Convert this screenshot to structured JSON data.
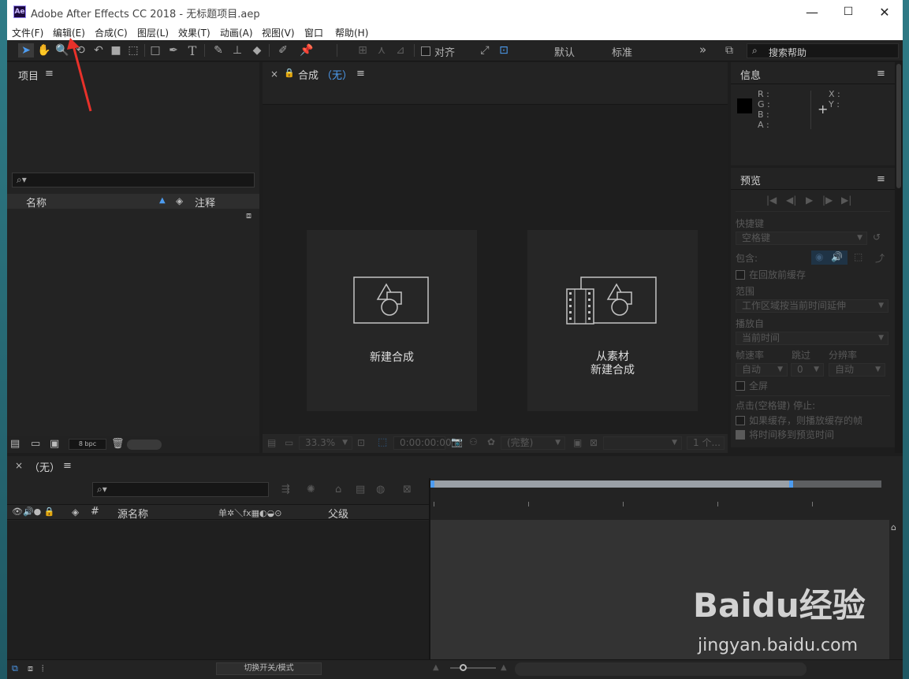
{
  "window": {
    "title": "Adobe After Effects CC 2018 - 无标题项目.aep",
    "logo_text": "Ae",
    "minimize": "—",
    "maximize": "☐",
    "close": "✕"
  },
  "menu": [
    "文件(F)",
    "编辑(E)",
    "合成(C)",
    "图层(L)",
    "效果(T)",
    "动画(A)",
    "视图(V)",
    "窗口",
    "帮助(H)"
  ],
  "toolbar": {
    "align_label": "对齐",
    "workspace_default": "默认",
    "workspace_standard": "标准",
    "more": "»",
    "search_placeholder": "搜索帮助"
  },
  "project_panel": {
    "title": "项目",
    "menu": "≡",
    "col_name": "名称",
    "col_comment": "注释",
    "bpc": "8 bpc"
  },
  "comp_panel": {
    "close": "×",
    "title": "合成",
    "comp_name": "（无）",
    "menu": "≡",
    "card_new_comp": "新建合成",
    "card_from_footage_line1": "从素材",
    "card_from_footage_line2": "新建合成",
    "zoom": "33.3%",
    "timecode": "0:00:00:00",
    "quality": "(完整)",
    "views": "1 个..."
  },
  "info_panel": {
    "title": "信息",
    "menu": "≡",
    "r": "R :",
    "g": "G :",
    "b": "B :",
    "a": "A :",
    "x": "X :",
    "y": "Y :",
    "swatch_color": "#000000"
  },
  "preview_panel": {
    "title": "预览",
    "menu": "≡",
    "shortcut_label": "快捷键",
    "shortcut_value": "空格键",
    "include_label": "包含:",
    "cache_before_play": "在回放前缓存",
    "range_label": "范围",
    "range_value": "工作区域按当前时间延伸",
    "play_from_label": "播放自",
    "play_from_value": "当前时间",
    "fps_label": "帧速率",
    "skip_label": "跳过",
    "res_label": "分辨率",
    "fps_value": "自动",
    "skip_value": "0",
    "res_value": "自动",
    "fullscreen": "全屏",
    "stop_label": "点击(空格键) 停止:",
    "opt1": "如果缓存，则播放缓存的帧",
    "opt2": "将时间移到预览时间"
  },
  "timeline": {
    "close": "×",
    "title": "（无）",
    "menu": "≡",
    "col_num": "#",
    "col_source": "源名称",
    "col_parent": "父级",
    "col_switches": "单✲＼fx▦◐◒⊙",
    "toggle_label": "切换开关/模式"
  },
  "watermark": {
    "brand": "Baidu经验",
    "url": "jingyan.baidu.com"
  },
  "accent": "#4d9cf0",
  "annotation_color": "#e8312a"
}
